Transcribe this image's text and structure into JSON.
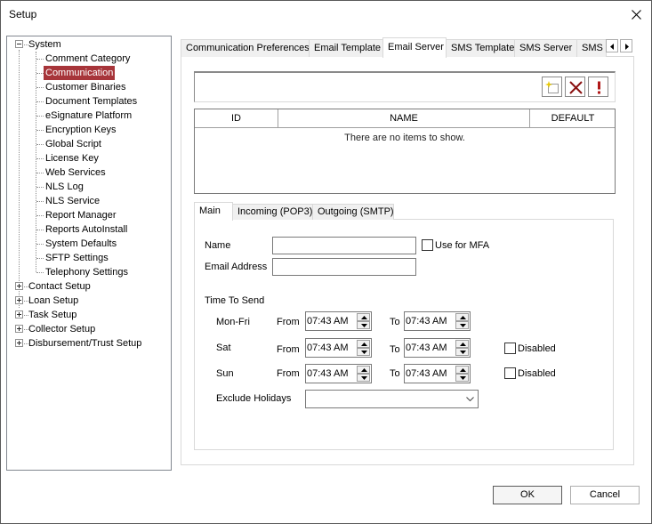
{
  "window": {
    "title": "Setup",
    "close_icon": "close-icon"
  },
  "tree": {
    "nodes": [
      {
        "label": "System",
        "expanded": true,
        "children": [
          {
            "label": "Comment Category"
          },
          {
            "label": "Communication",
            "selected": true
          },
          {
            "label": "Customer Binaries"
          },
          {
            "label": "Document Templates"
          },
          {
            "label": "eSignature Platform"
          },
          {
            "label": "Encryption Keys"
          },
          {
            "label": "Global Script"
          },
          {
            "label": "License Key"
          },
          {
            "label": "Web Services"
          },
          {
            "label": "NLS Log"
          },
          {
            "label": "NLS Service"
          },
          {
            "label": "Report Manager"
          },
          {
            "label": "Reports AutoInstall"
          },
          {
            "label": "System Defaults"
          },
          {
            "label": "SFTP Settings"
          },
          {
            "label": "Telephony Settings"
          }
        ]
      },
      {
        "label": "Contact Setup",
        "expanded": false
      },
      {
        "label": "Loan Setup",
        "expanded": false
      },
      {
        "label": "Task Setup",
        "expanded": false
      },
      {
        "label": "Collector Setup",
        "expanded": false
      },
      {
        "label": "Disbursement/Trust Setup",
        "expanded": false
      }
    ]
  },
  "tabs": [
    {
      "label": "Communication Preferences"
    },
    {
      "label": "Email Template"
    },
    {
      "label": "Email Server",
      "active": true
    },
    {
      "label": "SMS Template"
    },
    {
      "label": "SMS Server"
    },
    {
      "label": "SMS F"
    }
  ],
  "toolbar": {
    "new_icon": "new-item-icon",
    "delete_icon": "delete-x-icon",
    "alert_icon": "exclamation-icon"
  },
  "grid": {
    "columns": [
      "ID",
      "NAME",
      "DEFAULT"
    ],
    "rows": [],
    "empty_text": "There are no items to show."
  },
  "subtabs": [
    {
      "label": "Main",
      "active": true
    },
    {
      "label": "Incoming (POP3)"
    },
    {
      "label": "Outgoing (SMTP)"
    }
  ],
  "form": {
    "name_label": "Name",
    "name_value": "",
    "use_for_mfa_label": "Use for MFA",
    "use_for_mfa_checked": false,
    "email_label": "Email Address",
    "email_value": "",
    "time_to_send_label": "Time To Send",
    "from_label": "From",
    "to_label": "To",
    "disabled_label": "Disabled",
    "schedule": [
      {
        "day": "Mon-Fri",
        "from": "07:43 AM",
        "to": "07:43 AM"
      },
      {
        "day": "Sat",
        "from": "07:43 AM",
        "to": "07:43 AM",
        "disabled": false
      },
      {
        "day": "Sun",
        "from": "07:43 AM",
        "to": "07:43 AM",
        "disabled": false
      }
    ],
    "exclude_holidays_label": "Exclude Holidays",
    "exclude_holidays_value": ""
  },
  "buttons": {
    "ok": "OK",
    "cancel": "Cancel"
  }
}
